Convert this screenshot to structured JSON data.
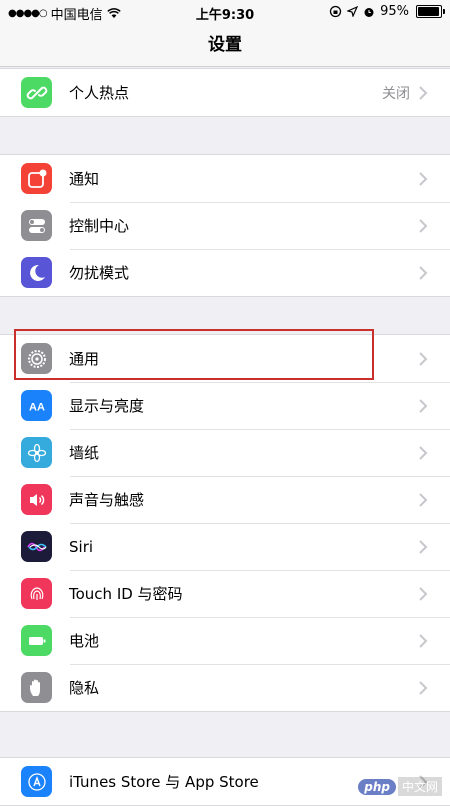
{
  "status_bar": {
    "carrier": "中国电信",
    "time": "上午9:30",
    "battery_text": "95%",
    "battery_level": 0.95
  },
  "nav": {
    "title": "设置"
  },
  "groups": [
    {
      "items": [
        {
          "label": "个人热点",
          "value": "关闭",
          "icon": "hotspot-icon",
          "color": "#4cd964"
        }
      ]
    },
    {
      "items": [
        {
          "label": "通知",
          "icon": "notifications-icon",
          "color": "#f44336"
        },
        {
          "label": "控制中心",
          "icon": "control-center-icon",
          "color": "#8e8e93"
        },
        {
          "label": "勿扰模式",
          "icon": "do-not-disturb-icon",
          "color": "#5856d6"
        }
      ]
    },
    {
      "items": [
        {
          "label": "通用",
          "icon": "gear-icon",
          "color": "#8e8e93"
        },
        {
          "label": "显示与亮度",
          "icon": "display-icon",
          "color": "#1a82fb"
        },
        {
          "label": "墙纸",
          "icon": "wallpaper-icon",
          "color": "#35aadc"
        },
        {
          "label": "声音与触感",
          "icon": "sound-icon",
          "color": "#f0365b"
        },
        {
          "label": "Siri",
          "icon": "siri-icon",
          "color": "#1c1c3a"
        },
        {
          "label": "Touch ID 与密码",
          "icon": "fingerprint-icon",
          "color": "#f0365b"
        },
        {
          "label": "电池",
          "icon": "battery-icon",
          "color": "#4cd964"
        },
        {
          "label": "隐私",
          "icon": "privacy-hand-icon",
          "color": "#8e8e93"
        }
      ]
    },
    {
      "items": [
        {
          "label": "iTunes Store 与 App Store",
          "icon": "app-store-icon",
          "color": "#1a82fb"
        }
      ]
    }
  ],
  "watermark": {
    "badge": "php",
    "text": "中文网"
  }
}
